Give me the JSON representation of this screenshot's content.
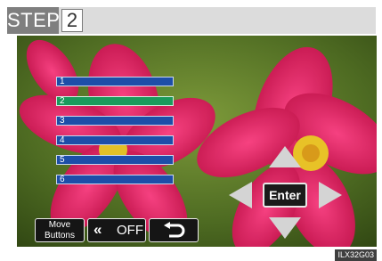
{
  "step": {
    "label": "STEP",
    "number": "2"
  },
  "memory_list": {
    "items": [
      {
        "label": "1",
        "selected": false
      },
      {
        "label": "2",
        "selected": true
      },
      {
        "label": "3",
        "selected": false
      },
      {
        "label": "4",
        "selected": false
      },
      {
        "label": "5",
        "selected": false
      },
      {
        "label": "6",
        "selected": false
      }
    ]
  },
  "dpad": {
    "enter_label": "Enter",
    "up_icon": "up-arrow-icon",
    "down_icon": "down-arrow-icon",
    "left_icon": "left-arrow-icon",
    "right_icon": "right-arrow-icon"
  },
  "bottom_buttons": {
    "move_line1": "Move",
    "move_line2": "Buttons",
    "off_chevron": "«",
    "off_label": "OFF",
    "back_icon": "return-icon"
  },
  "figure_code": "ILX32G03",
  "colors": {
    "list_row": "#1d4ea8",
    "list_row_selected": "#1a9b5c",
    "button_bg": "#151515",
    "arrow": "#d4d4d4"
  }
}
